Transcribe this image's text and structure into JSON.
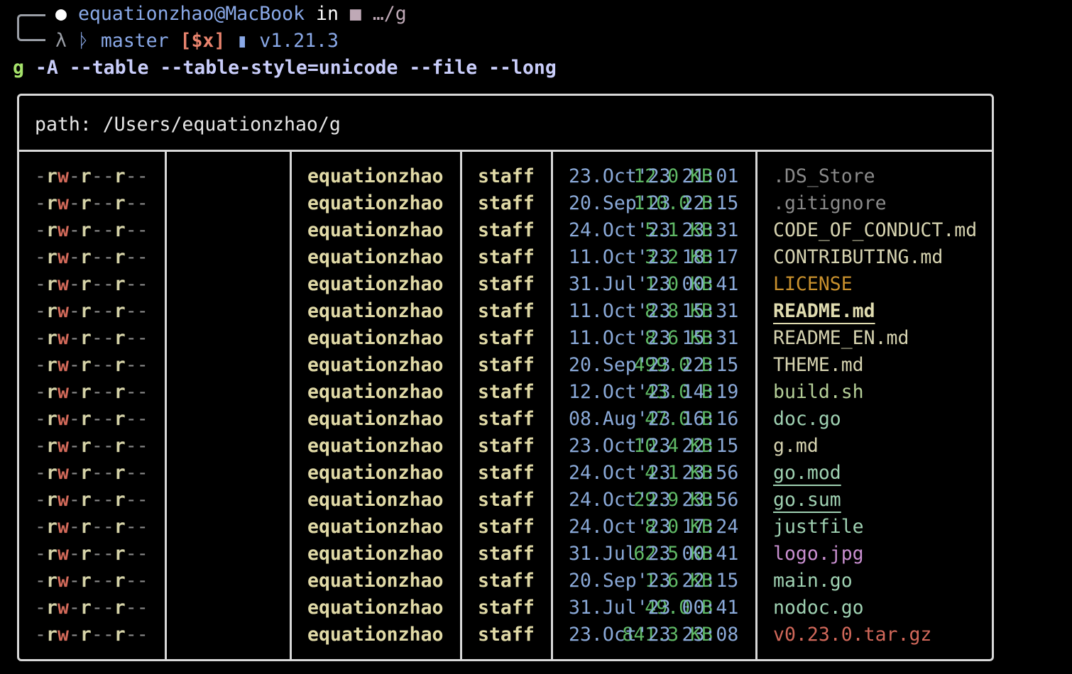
{
  "prompt": {
    "apple_icon": "apple-icon",
    "user_host": "equationzhao@MacBook",
    "in_label": "in",
    "folder_icon": "folder-icon",
    "cwd": "…/g",
    "lambda": "λ",
    "branch_icon": "git-branch-icon",
    "branch": "master",
    "git_status": "[$x]",
    "go_icon": "go-gopher-icon",
    "go_version": "v1.21.3",
    "command_name": "g",
    "command_args": " -A --table --table-style=unicode --file --long"
  },
  "table": {
    "path_label": "path: /Users/equationzhao/g",
    "colors": {
      "border": "#d8d8d8",
      "size": "#5fb865",
      "owner": "#e0d9a6",
      "time": "#8aa9d8"
    },
    "rows": [
      {
        "perm": "-rw-r--r--",
        "size": "12.0 KB",
        "owner": "equationzhao",
        "group": "staff",
        "time": "23.Oct'23 21:01",
        "name": ".DS_Store",
        "color": "#8a8a8a"
      },
      {
        "perm": "-rw-r--r--",
        "size": "110.0 B",
        "owner": "equationzhao",
        "group": "staff",
        "time": "20.Sep'23 22:15",
        "name": ".gitignore",
        "color": "#8a8a8a"
      },
      {
        "perm": "-rw-r--r--",
        "size": "5.1 KB",
        "owner": "equationzhao",
        "group": "staff",
        "time": "24.Oct'23 23:31",
        "name": "CODE_OF_CONDUCT.md",
        "color": "#d6d3b0"
      },
      {
        "perm": "-rw-r--r--",
        "size": "3.2 KB",
        "owner": "equationzhao",
        "group": "staff",
        "time": "11.Oct'23 18:17",
        "name": "CONTRIBUTING.md",
        "color": "#d6d3b0"
      },
      {
        "perm": "-rw-r--r--",
        "size": "1.0 KB",
        "owner": "equationzhao",
        "group": "staff",
        "time": "31.Jul'23 00:41",
        "name": "LICENSE",
        "color": "#c8902d"
      },
      {
        "perm": "-rw-r--r--",
        "size": "8.8 KB",
        "owner": "equationzhao",
        "group": "staff",
        "time": "11.Oct'23 15:31",
        "name": "README.md",
        "color": "#e0dcb0",
        "bold": true,
        "underline": true
      },
      {
        "perm": "-rw-r--r--",
        "size": "8.6 KB",
        "owner": "equationzhao",
        "group": "staff",
        "time": "11.Oct'23 15:31",
        "name": "README_EN.md",
        "color": "#d6d3b0"
      },
      {
        "perm": "-rw-r--r--",
        "size": "499.0 B",
        "owner": "equationzhao",
        "group": "staff",
        "time": "20.Sep'23 22:15",
        "name": "THEME.md",
        "color": "#d6d3b0"
      },
      {
        "perm": "-rw-r--r--",
        "size": "43.0 B",
        "owner": "equationzhao",
        "group": "staff",
        "time": "12.Oct'23 14:19",
        "name": "build.sh",
        "color": "#b5cf98"
      },
      {
        "perm": "-rw-r--r--",
        "size": "47.0 B",
        "owner": "equationzhao",
        "group": "staff",
        "time": "08.Aug'23 16:16",
        "name": "doc.go",
        "color": "#9fd1b2"
      },
      {
        "perm": "-rw-r--r--",
        "size": "10.4 KB",
        "owner": "equationzhao",
        "group": "staff",
        "time": "23.Oct'23 22:15",
        "name": "g.md",
        "color": "#d6d3b0"
      },
      {
        "perm": "-rw-r--r--",
        "size": "4.1 KB",
        "owner": "equationzhao",
        "group": "staff",
        "time": "24.Oct'23 23:56",
        "name": "go.mod",
        "color": "#9fd1b2",
        "underline": true
      },
      {
        "perm": "-rw-r--r--",
        "size": "29.9 KB",
        "owner": "equationzhao",
        "group": "staff",
        "time": "24.Oct'23 23:56",
        "name": "go.sum",
        "color": "#9fd1b2",
        "underline": true
      },
      {
        "perm": "-rw-r--r--",
        "size": "8.0 KB",
        "owner": "equationzhao",
        "group": "staff",
        "time": "24.Oct'23 17:24",
        "name": "justfile",
        "color": "#9fd1b2"
      },
      {
        "perm": "-rw-r--r--",
        "size": "62.5 KB",
        "owner": "equationzhao",
        "group": "staff",
        "time": "31.Jul'23 00:41",
        "name": "logo.jpg",
        "color": "#c98fd0"
      },
      {
        "perm": "-rw-r--r--",
        "size": "1.6 KB",
        "owner": "equationzhao",
        "group": "staff",
        "time": "20.Sep'23 22:15",
        "name": "main.go",
        "color": "#9fd1b2"
      },
      {
        "perm": "-rw-r--r--",
        "size": "49.0 B",
        "owner": "equationzhao",
        "group": "staff",
        "time": "31.Jul'23 00:41",
        "name": "nodoc.go",
        "color": "#9fd1b2"
      },
      {
        "perm": "-rw-r--r--",
        "size": "841.3 KB",
        "owner": "equationzhao",
        "group": "staff",
        "time": "23.Oct'23 23:08",
        "name": "v0.23.0.tar.gz",
        "color": "#d1685a"
      }
    ]
  }
}
